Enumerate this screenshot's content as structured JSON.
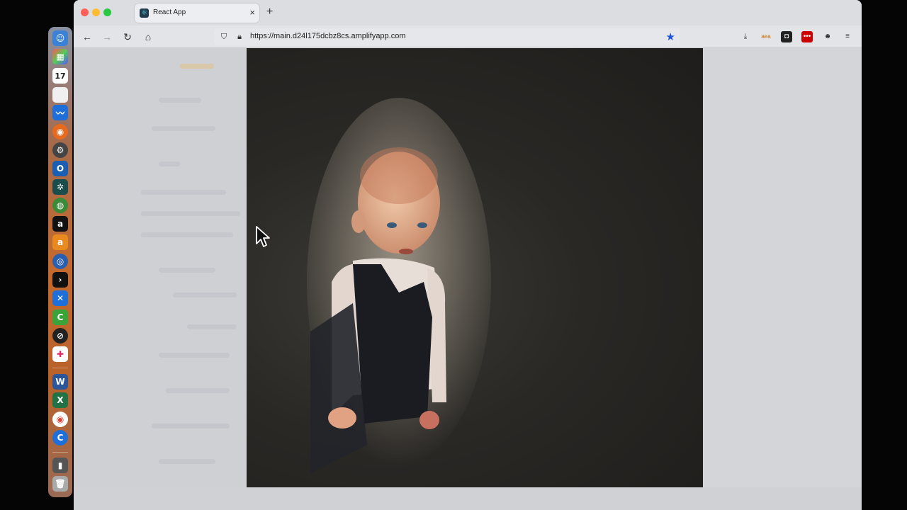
{
  "browser": {
    "tab_title": "React App",
    "url": "https://main.d24l175dcbz8cs.amplifyapp.com",
    "new_tab_symbol": "+",
    "close_symbol": "×"
  },
  "dock": {
    "calendar_day": "17"
  },
  "colors": {
    "accent_star": "#1a56d6",
    "close_red": "#ff5f57",
    "minimize_yellow": "#febc2e",
    "zoom_green": "#28c840"
  }
}
